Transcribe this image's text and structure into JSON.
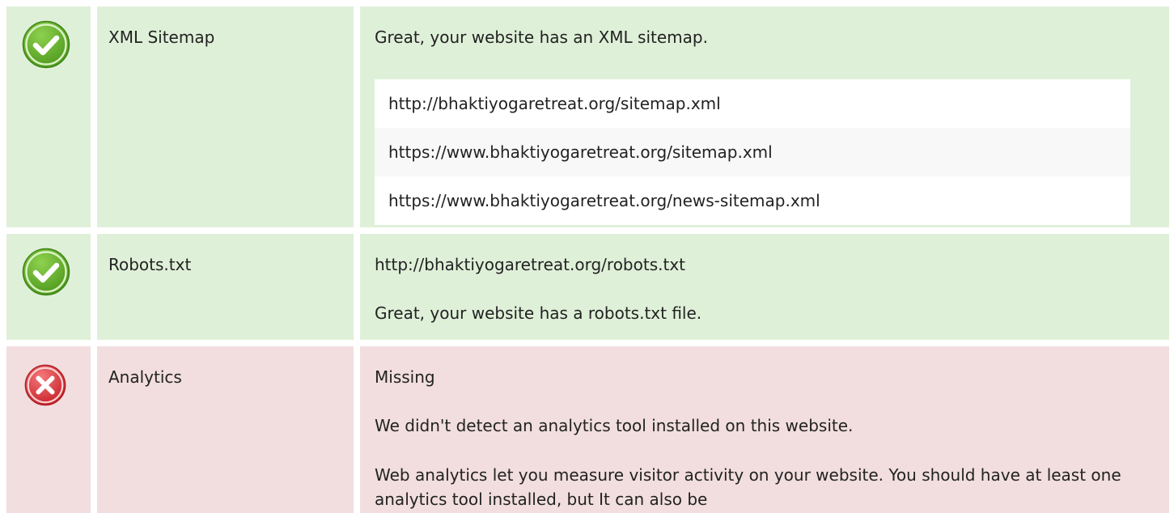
{
  "rows": [
    {
      "status": "pass",
      "status_icon": "check-circle-icon",
      "label": "XML Sitemap",
      "message": "Great, your website has an XML sitemap.",
      "sitemaps": [
        "http://bhaktiyogaretreat.org/sitemap.xml",
        "https://www.bhaktiyogaretreat.org/sitemap.xml",
        "https://www.bhaktiyogaretreat.org/news-sitemap.xml"
      ]
    },
    {
      "status": "pass",
      "status_icon": "check-circle-icon",
      "label": "Robots.txt",
      "url": "http://bhaktiyogaretreat.org/robots.txt",
      "message": "Great, your website has a robots.txt file."
    },
    {
      "status": "fail",
      "status_icon": "cross-circle-icon",
      "label": "Analytics",
      "value": "Missing",
      "message": "We didn't detect an analytics tool installed on this website.",
      "paragraph": "Web analytics let you measure visitor activity on your website. You should have at least one analytics tool installed, but It can also be"
    }
  ],
  "colors": {
    "pass_background": "#dff0d8",
    "fail_background": "#f2dede",
    "pass_icon": "#6bb52a",
    "fail_icon": "#e0393e"
  }
}
